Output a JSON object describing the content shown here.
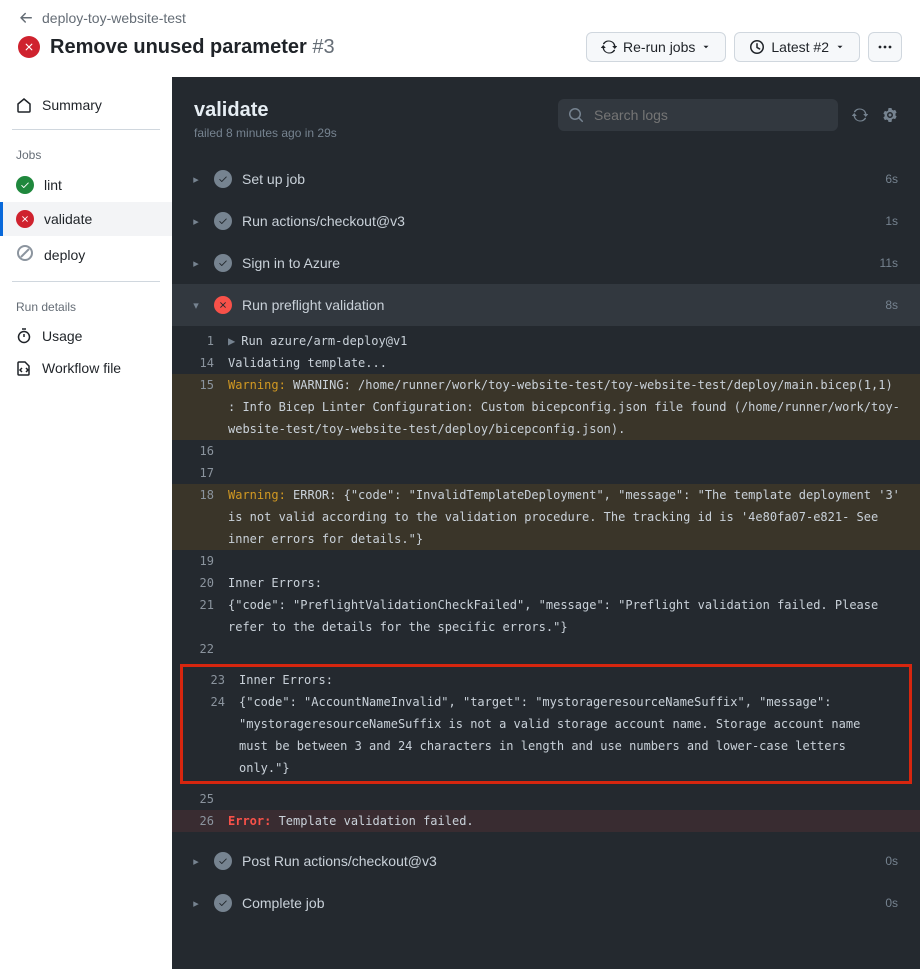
{
  "header": {
    "back_label": "deploy-toy-website-test",
    "title": "Remove unused parameter",
    "run_number": "#3",
    "rerun_label": "Re-run jobs",
    "latest_label": "Latest #2",
    "search_placeholder": "Search logs"
  },
  "sidebar": {
    "summary": "Summary",
    "jobs_heading": "Jobs",
    "jobs": [
      {
        "label": "lint",
        "status": "success"
      },
      {
        "label": "validate",
        "status": "fail",
        "active": true
      },
      {
        "label": "deploy",
        "status": "skipped"
      }
    ],
    "run_details_heading": "Run details",
    "usage": "Usage",
    "workflow": "Workflow file"
  },
  "job": {
    "title": "validate",
    "subtitle": "failed 8 minutes ago in 29s"
  },
  "steps": [
    {
      "label": "Set up job",
      "status": "pass",
      "duration": "6s",
      "expanded": false
    },
    {
      "label": "Run actions/checkout@v3",
      "status": "pass",
      "duration": "1s",
      "expanded": false
    },
    {
      "label": "Sign in to Azure",
      "status": "pass",
      "duration": "11s",
      "expanded": false
    },
    {
      "label": "Run preflight validation",
      "status": "fail",
      "duration": "8s",
      "expanded": true
    },
    {
      "label": "Post Run actions/checkout@v3",
      "status": "pass",
      "duration": "0s",
      "expanded": false
    },
    {
      "label": "Complete job",
      "status": "pass",
      "duration": "0s",
      "expanded": false
    }
  ],
  "log": {
    "lines": [
      {
        "n": "1",
        "cls": "",
        "prefix": "run",
        "text": "Run azure/arm-deploy@v1"
      },
      {
        "n": "14",
        "cls": "",
        "prefix": "",
        "text": "Validating template..."
      },
      {
        "n": "15",
        "cls": "warn",
        "prefix": "warn",
        "text": "WARNING: /home/runner/work/toy-website-test/toy-website-test/deploy/main.bicep(1,1) : Info Bicep Linter Configuration: Custom bicepconfig.json file found (/home/runner/work/toy-website-test/toy-website-test/deploy/bicepconfig.json)."
      },
      {
        "n": "16",
        "cls": "",
        "prefix": "",
        "text": ""
      },
      {
        "n": "17",
        "cls": "",
        "prefix": "",
        "text": ""
      },
      {
        "n": "18",
        "cls": "warn",
        "prefix": "warn",
        "text": "ERROR: {\"code\": \"InvalidTemplateDeployment\", \"message\": \"The template deployment '3' is not valid according to the validation procedure. The tracking id is '4e80fa07-e821- See inner errors for details.\"}"
      },
      {
        "n": "19",
        "cls": "",
        "prefix": "",
        "text": ""
      },
      {
        "n": "20",
        "cls": "",
        "prefix": "",
        "text": "Inner Errors:"
      },
      {
        "n": "21",
        "cls": "",
        "prefix": "",
        "text": "{\"code\": \"PreflightValidationCheckFailed\", \"message\": \"Preflight validation failed. Please refer to the details for the specific errors.\"}"
      },
      {
        "n": "22",
        "cls": "",
        "prefix": "",
        "text": ""
      },
      {
        "n": "23",
        "cls": "",
        "prefix": "",
        "text": "Inner Errors:",
        "hl": true
      },
      {
        "n": "24",
        "cls": "",
        "prefix": "",
        "text": "{\"code\": \"AccountNameInvalid\", \"target\": \"mystorageresourceNameSuffix\", \"message\": \"mystorageresourceNameSuffix is not a valid storage account name. Storage account name must be between 3 and 24 characters in length and use numbers and lower-case letters only.\"}",
        "hl": true
      },
      {
        "n": "25",
        "cls": "",
        "prefix": "",
        "text": ""
      },
      {
        "n": "26",
        "cls": "err",
        "prefix": "err",
        "text": "Template validation failed."
      }
    ],
    "warn_kw": "Warning:",
    "err_kw": "Error:"
  }
}
